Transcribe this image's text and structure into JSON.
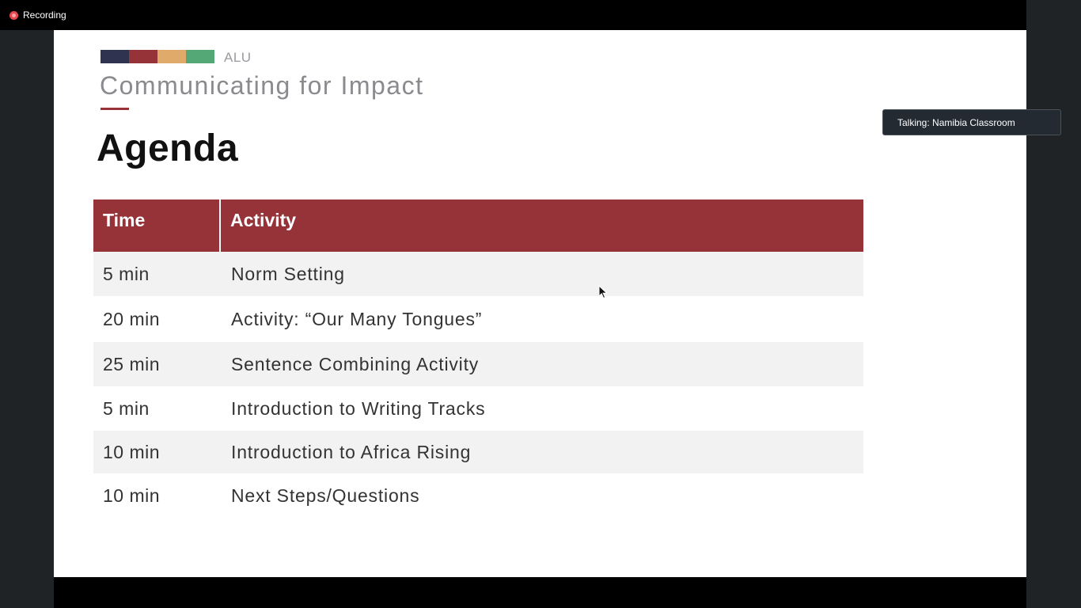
{
  "recording": {
    "label": "Recording",
    "icon": "record-dot-icon"
  },
  "slide": {
    "brand": "ALU",
    "brand_colors": [
      "#2f3350",
      "#953338",
      "#e0aa6a",
      "#54a875"
    ],
    "course_title": "Communicating for Impact",
    "heading": "Agenda",
    "table": {
      "header_color": "#953338",
      "headers": {
        "time": "Time",
        "activity": "Activity"
      },
      "rows": [
        {
          "time": "5 min",
          "activity": "Norm Setting"
        },
        {
          "time": "20 min",
          "activity": "Activity: “Our Many Tongues”"
        },
        {
          "time": "25 min",
          "activity": "Sentence Combining Activity"
        },
        {
          "time": "5 min",
          "activity": "Introduction to Writing Tracks"
        },
        {
          "time": "10 min",
          "activity": "Introduction to Africa Rising"
        },
        {
          "time": "10 min",
          "activity": "Next Steps/Questions"
        }
      ]
    }
  },
  "speaker": {
    "label": "Talking: Namibia Classroom"
  }
}
